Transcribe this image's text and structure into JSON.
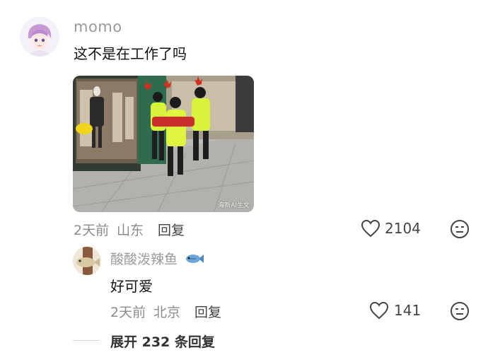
{
  "comment": {
    "username": "momo",
    "text": "这不是在工作了吗",
    "time": "2天前",
    "location": "山东",
    "reply_label": "回复",
    "likes": "2104",
    "photo_caption": "海新AI生文"
  },
  "reply": {
    "username": "酸酸泼辣鱼",
    "text": "好可爱",
    "time": "2天前",
    "location": "北京",
    "reply_label": "回复",
    "likes": "141"
  },
  "expand_label": "展开 232 条回复",
  "icons": {
    "like": "heart-outline-icon",
    "dislike": "neutral-face-icon",
    "fish": "fish-emoji-icon"
  },
  "colors": {
    "secondary_text": "#8c8c8c",
    "primary_text": "#111111",
    "background": "#ffffff"
  }
}
